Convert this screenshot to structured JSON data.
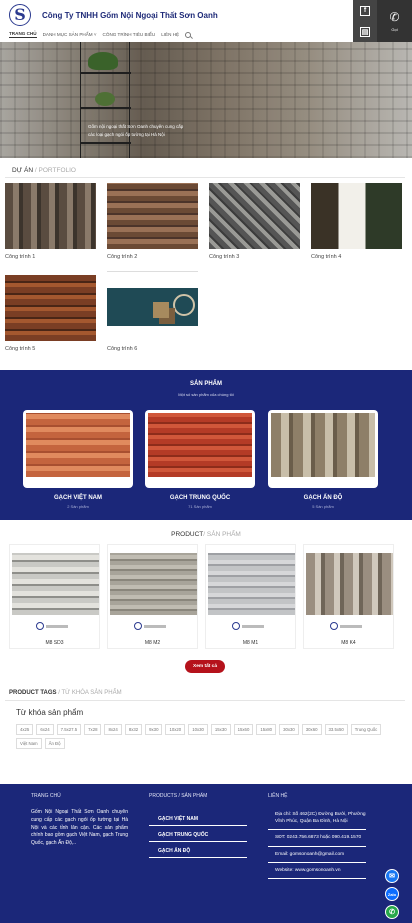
{
  "header": {
    "logo_letter": "S",
    "company": "Công Ty TNHH Gốm Nội Ngoại Thất Sơn Oanh",
    "nav": [
      {
        "label": "TRANG CHỦ",
        "active": true
      },
      {
        "label": "DANH MỤC SẢN PHẨM ˅",
        "active": false
      },
      {
        "label": "CÔNG TRÌNH TIÊU BIỂU",
        "active": false
      },
      {
        "label": "LIÊN HỆ",
        "active": false
      }
    ],
    "social": {
      "facebook": "f",
      "chat": "▤"
    },
    "call_label": "Gọi"
  },
  "hero": {
    "caption_line1": "Gốm nội ngoại thất Sơn Oanh chuyên cung cấp",
    "caption_line2": "các loại gạch ngói ốp tường tại Hà Nội"
  },
  "projects": {
    "title": "DỰ ÁN",
    "subtitle": "PORTFOLIO",
    "items": [
      {
        "label": "Công trình 1"
      },
      {
        "label": "Công trình 2"
      },
      {
        "label": "Công trình 3"
      },
      {
        "label": "Công trình 4"
      },
      {
        "label": "Công trình 5"
      },
      {
        "label": "Công trình 6"
      }
    ]
  },
  "categories": {
    "title": "SẢN PHẨM",
    "subtitle": "Một số sản phẩm của chúng tôi",
    "items": [
      {
        "name": "GẠCH VIỆT NAM",
        "count": "2 Sản phẩm"
      },
      {
        "name": "GẠCH TRUNG QUỐC",
        "count": "71 Sản phẩm"
      },
      {
        "name": "GẠCH ẤN ĐỘ",
        "count": "5 Sản phẩm"
      }
    ]
  },
  "products": {
    "title": "PRODUCT",
    "subtitle": "/ SẢN PHẨM",
    "items": [
      {
        "name": "M8 SD3"
      },
      {
        "name": "M8 M2"
      },
      {
        "name": "M8 M1"
      },
      {
        "name": "M8 K4"
      }
    ],
    "more_button": "Xem tất cả"
  },
  "tags": {
    "title": "PRODUCT TAGS",
    "subtitle": "/ TỪ KHÓA SẢN PHẨM",
    "keyword_title": "Từ khóa sản phẩm",
    "items": [
      "4x25",
      "6x24",
      "7.5x27.5",
      "7x28",
      "8x24",
      "8x32",
      "9x30",
      "10x20",
      "10x30",
      "15x30",
      "15x60",
      "15x80",
      "30x30",
      "30x60",
      "33.5x50",
      "Trung Quốc",
      "Việt Nam",
      "Ấn Độ"
    ]
  },
  "footer": {
    "about_title": "TRANG CHỦ",
    "about_text": "Gốm Nội Ngoại Thất Sơn Oanh chuyên cung cấp các gạch ngói ốp tường tại Hà Nội và các tỉnh lân cận. Các sản phẩm chính bao gồm gạch Việt Nam, gạch Trung Quốc, gạch Ấn Độ,..",
    "products_title": "PRODUCTS / SẢN PHẨM",
    "product_links": [
      "GẠCH VIỆT NAM",
      "GẠCH TRUNG QUỐC",
      "GẠCH ẤN ĐỘ"
    ],
    "contact_title": "LIÊN HỆ",
    "address": "Địa chỉ: Số 462(2C) Đường Bưởi, Phường Vĩnh Phúc, Quận Ba Đình, Hà Nội",
    "phone": "SĐT: 0243.756.6873 hoặc 090.419.1570",
    "email": "Email: gomsonoanh@gmail.com",
    "website": "Website: www.gomsonoanh.vn"
  },
  "floating": {
    "messenger": "✉",
    "zalo": "Zalo",
    "phone": "✆"
  },
  "colors": {
    "primary_blue": "#1b2779",
    "button_red": "#b5121b"
  }
}
